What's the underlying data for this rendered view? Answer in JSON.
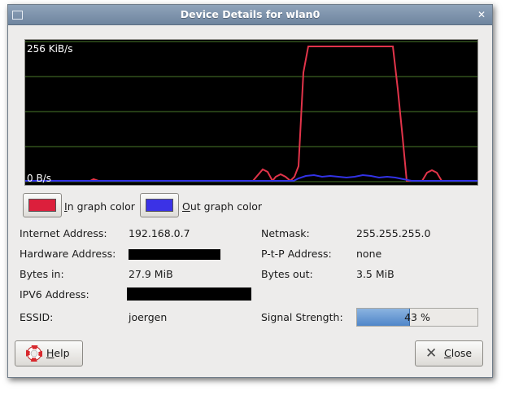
{
  "window": {
    "title": "Device Details for wlan0"
  },
  "graph": {
    "max_label": "256 KiB/s",
    "min_label": "0 B/s",
    "colors": {
      "in": "#e2344a",
      "out": "#3232e6",
      "grid": "#4a7a2a"
    }
  },
  "legend": {
    "in": {
      "accel": "I",
      "rest": "n graph color",
      "color": "#dc1f3c"
    },
    "out": {
      "accel": "O",
      "rest": "ut graph color",
      "color": "#3b32e6"
    }
  },
  "details": {
    "internet_address": {
      "label": "Internet Address:",
      "value": "192.168.0.7"
    },
    "netmask": {
      "label": "Netmask:",
      "value": "255.255.255.0"
    },
    "hardware_address": {
      "label": "Hardware Address:"
    },
    "ptp_address": {
      "label": "P-t-P Address:",
      "value": "none"
    },
    "bytes_in": {
      "label": "Bytes in:",
      "value": "27.9 MiB"
    },
    "bytes_out": {
      "label": "Bytes out:",
      "value": "3.5 MiB"
    },
    "ipv6_address": {
      "label": "IPV6 Address:"
    },
    "essid": {
      "label": "ESSID:",
      "value": "joergen"
    },
    "signal_strength": {
      "label": "Signal Strength:",
      "percent": 43,
      "text": "43 %"
    }
  },
  "buttons": {
    "help": {
      "accel": "H",
      "rest": "elp"
    },
    "close": {
      "accel": "C",
      "rest": "lose"
    }
  }
}
